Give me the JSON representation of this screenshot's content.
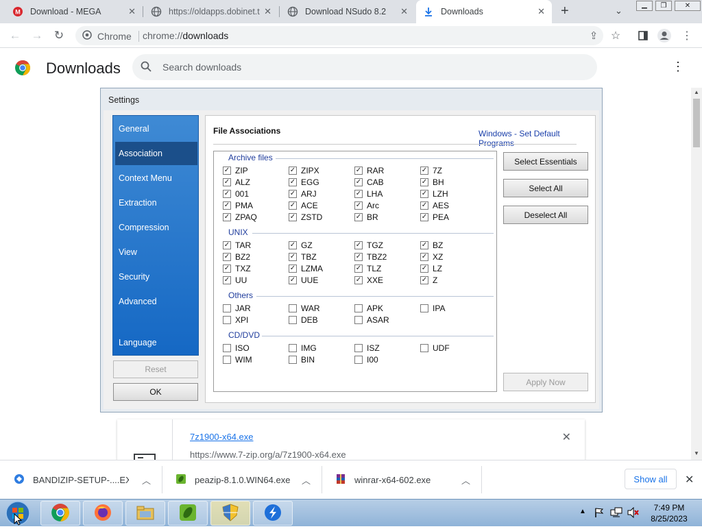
{
  "tabs": [
    {
      "title": "Download - MEGA",
      "icon": "mega-icon"
    },
    {
      "title": "https://oldapps.dobinet.t",
      "icon": "globe-icon"
    },
    {
      "title": "Download NSudo 8.2",
      "icon": "globe-icon"
    },
    {
      "title": "Downloads",
      "icon": "download-icon",
      "active": true
    }
  ],
  "toolbar": {
    "chip_label": "Chrome",
    "url_scheme": "chrome://",
    "url_path": "downloads"
  },
  "downloads_page": {
    "title": "Downloads",
    "search_placeholder": "Search downloads"
  },
  "settings": {
    "window_title": "Settings",
    "nav": [
      {
        "label": "General"
      },
      {
        "label": "Association",
        "selected": true
      },
      {
        "label": "Context Menu"
      },
      {
        "label": "Extraction"
      },
      {
        "label": "Compression"
      },
      {
        "label": "View"
      },
      {
        "label": "Security"
      },
      {
        "label": "Advanced"
      },
      {
        "label": "Language"
      }
    ],
    "reset_label": "Reset",
    "ok_label": "OK",
    "section_title": "File Associations",
    "default_programs_link": "Windows - Set Default Programs",
    "select_essentials_label": "Select Essentials",
    "select_all_label": "Select All",
    "deselect_all_label": "Deselect All",
    "apply_now_label": "Apply Now",
    "groups": [
      {
        "label": "Archive files",
        "items": [
          {
            "ext": "ZIP",
            "checked": true
          },
          {
            "ext": "ZIPX",
            "checked": true
          },
          {
            "ext": "RAR",
            "checked": true
          },
          {
            "ext": "7Z",
            "checked": true
          },
          {
            "ext": "ALZ",
            "checked": true
          },
          {
            "ext": "EGG",
            "checked": true
          },
          {
            "ext": "CAB",
            "checked": true
          },
          {
            "ext": "BH",
            "checked": true
          },
          {
            "ext": "001",
            "checked": true
          },
          {
            "ext": "ARJ",
            "checked": true
          },
          {
            "ext": "LHA",
            "checked": true
          },
          {
            "ext": "LZH",
            "checked": true
          },
          {
            "ext": "PMA",
            "checked": true
          },
          {
            "ext": "ACE",
            "checked": true
          },
          {
            "ext": "Arc",
            "checked": true
          },
          {
            "ext": "AES",
            "checked": true
          },
          {
            "ext": "ZPAQ",
            "checked": true
          },
          {
            "ext": "ZSTD",
            "checked": true
          },
          {
            "ext": "BR",
            "checked": true
          },
          {
            "ext": "PEA",
            "checked": true
          }
        ]
      },
      {
        "label": "UNIX",
        "items": [
          {
            "ext": "TAR",
            "checked": true
          },
          {
            "ext": "GZ",
            "checked": true
          },
          {
            "ext": "TGZ",
            "checked": true
          },
          {
            "ext": "BZ",
            "checked": true
          },
          {
            "ext": "BZ2",
            "checked": true
          },
          {
            "ext": "TBZ",
            "checked": true
          },
          {
            "ext": "TBZ2",
            "checked": true
          },
          {
            "ext": "XZ",
            "checked": true
          },
          {
            "ext": "TXZ",
            "checked": true
          },
          {
            "ext": "LZMA",
            "checked": true
          },
          {
            "ext": "TLZ",
            "checked": true
          },
          {
            "ext": "LZ",
            "checked": true
          },
          {
            "ext": "UU",
            "checked": true
          },
          {
            "ext": "UUE",
            "checked": true
          },
          {
            "ext": "XXE",
            "checked": true
          },
          {
            "ext": "Z",
            "checked": true
          }
        ]
      },
      {
        "label": "Others",
        "items": [
          {
            "ext": "JAR",
            "checked": false
          },
          {
            "ext": "WAR",
            "checked": false
          },
          {
            "ext": "APK",
            "checked": false
          },
          {
            "ext": "IPA",
            "checked": false
          },
          {
            "ext": "XPI",
            "checked": false
          },
          {
            "ext": "DEB",
            "checked": false
          },
          {
            "ext": "ASAR",
            "checked": false
          }
        ]
      },
      {
        "label": "CD/DVD",
        "items": [
          {
            "ext": "ISO",
            "checked": false
          },
          {
            "ext": "IMG",
            "checked": false
          },
          {
            "ext": "ISZ",
            "checked": false
          },
          {
            "ext": "UDF",
            "checked": false
          },
          {
            "ext": "WIM",
            "checked": false
          },
          {
            "ext": "BIN",
            "checked": false
          },
          {
            "ext": "I00",
            "checked": false
          }
        ]
      }
    ]
  },
  "download_item": {
    "filename": "7z1900-x64.exe",
    "url": "https://www.7-zip.org/a/7z1900-x64.exe"
  },
  "shelf": {
    "items": [
      {
        "name": "BANDIZIP-SETUP-....EXE",
        "icon": "bandizip-installer-icon"
      },
      {
        "name": "peazip-8.1.0.WIN64.exe",
        "icon": "peazip-icon"
      },
      {
        "name": "winrar-x64-602.exe",
        "icon": "winrar-icon"
      }
    ],
    "show_all_label": "Show all"
  },
  "taskbar": {
    "time": "7:49 PM",
    "date": "8/25/2023",
    "apps": [
      "chrome-icon",
      "firefox-icon",
      "explorer-icon",
      "peazip-icon",
      "security-shield-icon",
      "blue-arrow-app-icon"
    ]
  },
  "colors": {
    "accent": "#1a73e8",
    "nav_gradient_top": "#3f8ad4",
    "nav_gradient_bottom": "#1568c4",
    "nav_selected": "#1b4f8a",
    "group_label": "#1f3c9c"
  }
}
